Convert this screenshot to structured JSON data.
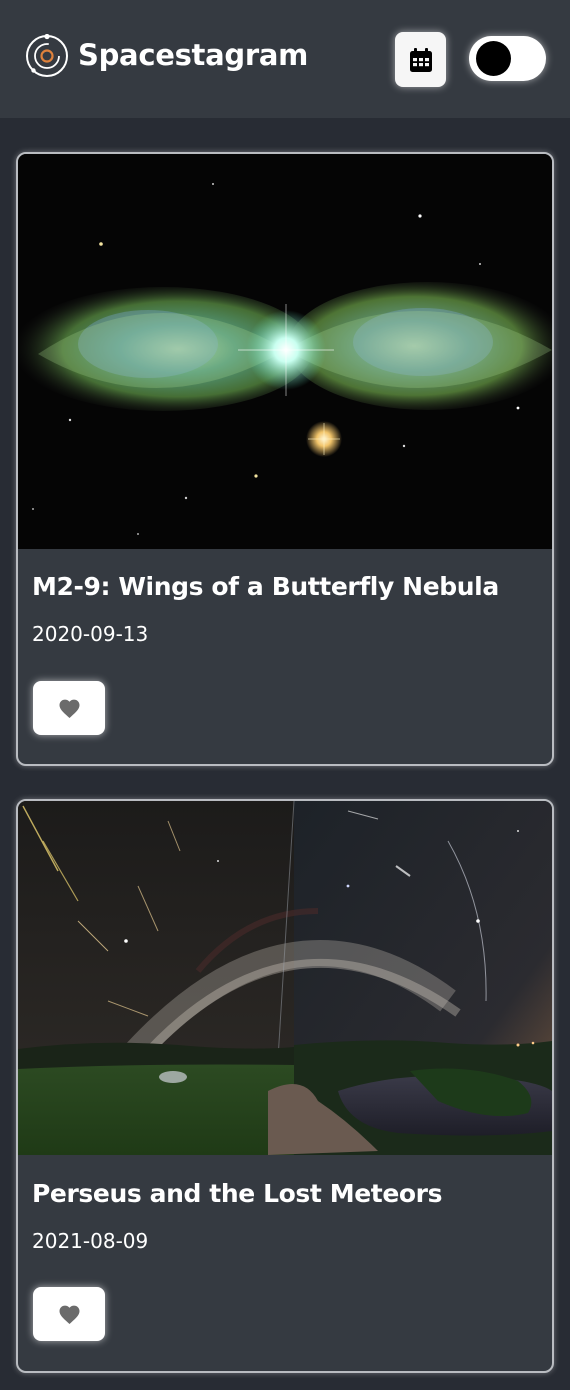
{
  "app": {
    "title": "Spacestagram"
  },
  "header": {
    "logo_icon": "orbit-planet-icon",
    "calendar_icon": "calendar-icon",
    "theme_toggle": {
      "state": "off"
    }
  },
  "posts": [
    {
      "title": "M2-9: Wings of a Butterfly Nebula",
      "date": "2020-09-13",
      "like_icon": "heart-icon"
    },
    {
      "title": "Perseus and the Lost Meteors",
      "date": "2021-08-09",
      "like_icon": "heart-icon"
    }
  ],
  "colors": {
    "background": "#282c34",
    "surface": "#353a41",
    "text": "#ffffff",
    "icon_muted": "#6b6b6b"
  }
}
